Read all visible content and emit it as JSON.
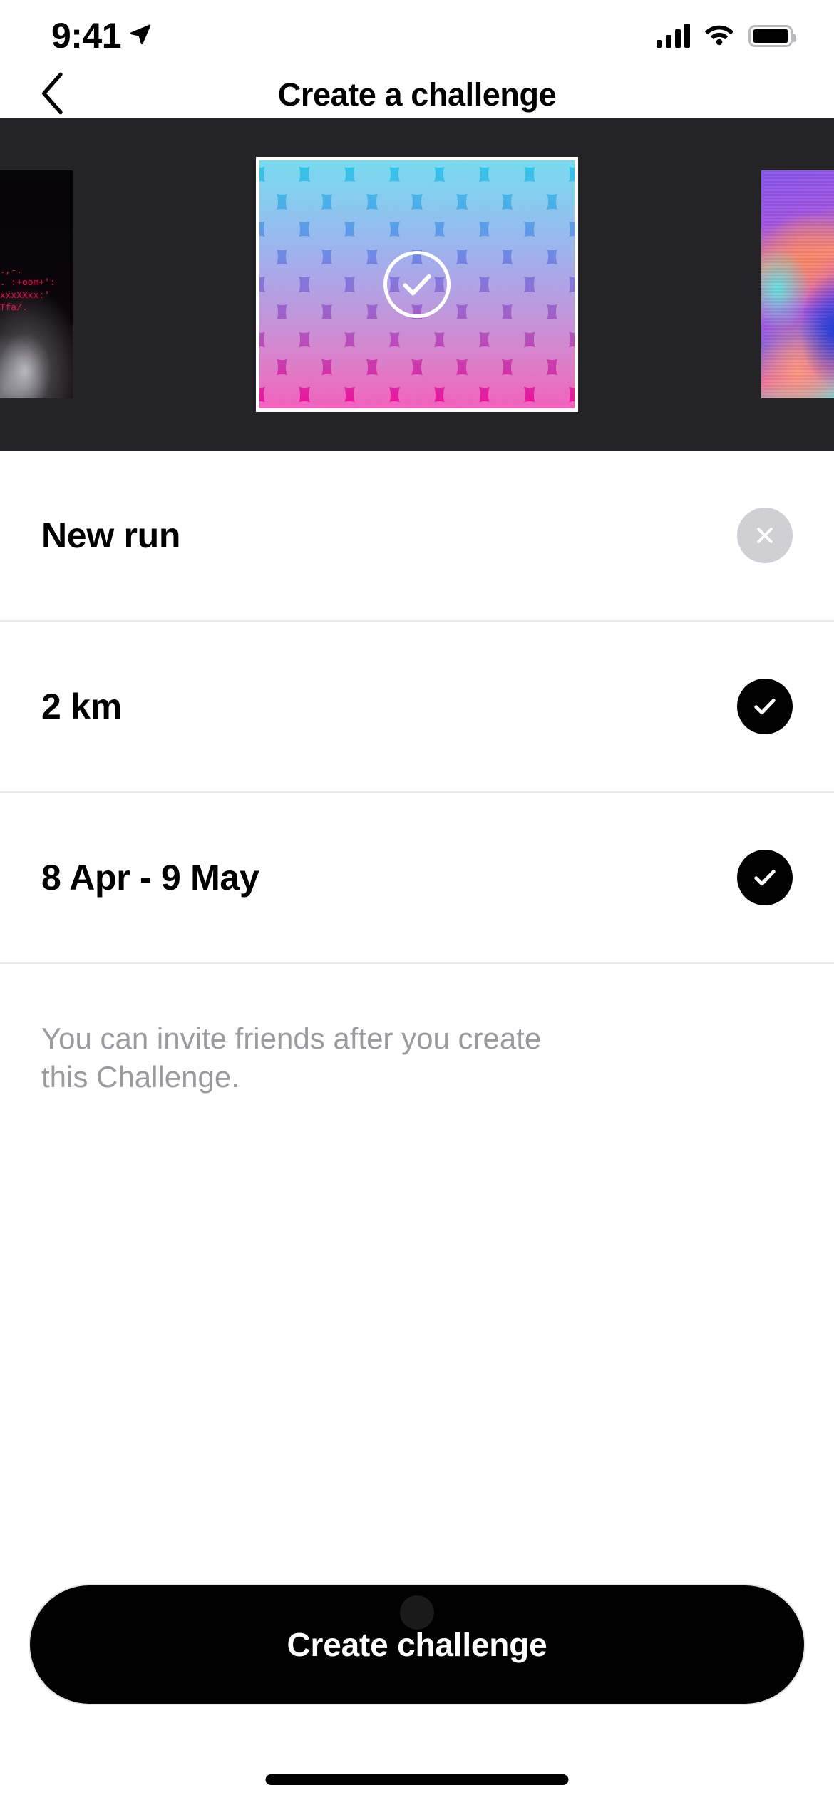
{
  "status_bar": {
    "time": "9:41",
    "location_icon": "location-arrow-icon",
    "signal_icon": "cellular-signal-icon",
    "signal_bars": 4,
    "wifi_icon": "wifi-icon",
    "battery_icon": "battery-icon",
    "battery_level": 100
  },
  "nav": {
    "back_icon": "chevron-left-icon",
    "title": "Create a challenge"
  },
  "carousel": {
    "background_color": "#242326",
    "selected_index": 1,
    "selected_check_icon": "check-circle-outline-icon",
    "cards": [
      {
        "name": "dark-smoke-card",
        "position": "left",
        "selected": false,
        "art_type": "dark-photo",
        "glyph_lines": [
          "'.,-.",
          "'. :+oom+':",
          "+xxxXXxx:'",
          "STfa/."
        ]
      },
      {
        "name": "gradient-wave-card",
        "position": "center",
        "selected": true,
        "art_type": "gradient-blob-pattern",
        "gradient_top": "#2fc7e8",
        "gradient_mid": "#8a6fd6",
        "gradient_bottom": "#ec0d9b"
      },
      {
        "name": "abstract-color-card",
        "position": "right",
        "selected": false,
        "art_type": "abstract-gradient"
      }
    ]
  },
  "list": {
    "rows": [
      {
        "label": "New run",
        "name": "challenge-name-row",
        "badge": "clear",
        "badge_icon": "close-icon",
        "badge_color": "#cfcfd4"
      },
      {
        "label": "2 km",
        "name": "challenge-distance-row",
        "badge": "done",
        "badge_icon": "check-icon",
        "badge_color": "#000000"
      },
      {
        "label": "8 Apr - 9 May",
        "name": "challenge-dates-row",
        "badge": "done",
        "badge_icon": "check-icon",
        "badge_color": "#000000"
      }
    ]
  },
  "helper_text": "You can invite friends after you create this Challenge.",
  "cta": {
    "label": "Create challenge",
    "background_color": "#000000",
    "text_color": "#ffffff"
  },
  "home_indicator": "home-indicator"
}
